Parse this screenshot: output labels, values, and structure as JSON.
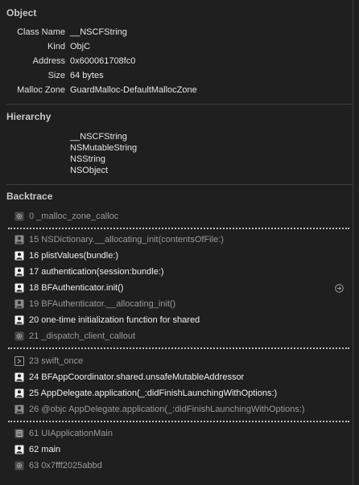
{
  "object": {
    "title": "Object",
    "rows": [
      {
        "label": "Class Name",
        "value": "__NSCFString"
      },
      {
        "label": "Kind",
        "value": "ObjC"
      },
      {
        "label": "Address",
        "value": "0x600061708fc0"
      },
      {
        "label": "Size",
        "value": "64 bytes"
      },
      {
        "label": "Malloc Zone",
        "value": "GuardMalloc-DefaultMallocZone"
      }
    ]
  },
  "hierarchy": {
    "title": "Hierarchy",
    "items": [
      "__NSCFString",
      "NSMutableString",
      "NSString",
      "NSObject"
    ]
  },
  "backtrace": {
    "title": "Backtrace",
    "frames": [
      {
        "label": "0 _malloc_zone_calloc",
        "icon": "gear-icon",
        "kind": "sys"
      },
      {
        "label": "15 NSDictionary.__allocating_init(contentsOfFile:)",
        "icon": "user-icon",
        "kind": "sys"
      },
      {
        "label": "16 plistValues(bundle:)",
        "icon": "user-icon",
        "kind": "user"
      },
      {
        "label": "17 authentication(session:bundle:)",
        "icon": "user-icon",
        "kind": "user"
      },
      {
        "label": "18 BFAuthenticator.init()",
        "icon": "user-icon",
        "kind": "user"
      },
      {
        "label": "19 BFAuthenticator.__allocating_init()",
        "icon": "user-icon",
        "kind": "sys"
      },
      {
        "label": "20 one-time initialization function for shared",
        "icon": "user-icon",
        "kind": "user"
      },
      {
        "label": "21 _dispatch_client_callout",
        "icon": "gear-icon",
        "kind": "sys"
      },
      {
        "label": "23 swift_once",
        "icon": "swift-icon",
        "kind": "sys"
      },
      {
        "label": "24 BFAppCoordinator.shared.unsafeMutableAddressor",
        "icon": "user-icon",
        "kind": "user"
      },
      {
        "label": "25 AppDelegate.application(_:didFinishLaunchingWithOptions:)",
        "icon": "user-icon",
        "kind": "user"
      },
      {
        "label": "26 @objc AppDelegate.application(_:didFinishLaunchingWithOptions:)",
        "icon": "user-icon",
        "kind": "sys"
      },
      {
        "label": "61 UIApplicationMain",
        "icon": "app-icon",
        "kind": "sys"
      },
      {
        "label": "62 main",
        "icon": "user-icon",
        "kind": "user"
      },
      {
        "label": "63 0x7fff2025abbd",
        "icon": "gear-icon",
        "kind": "sys"
      }
    ]
  }
}
